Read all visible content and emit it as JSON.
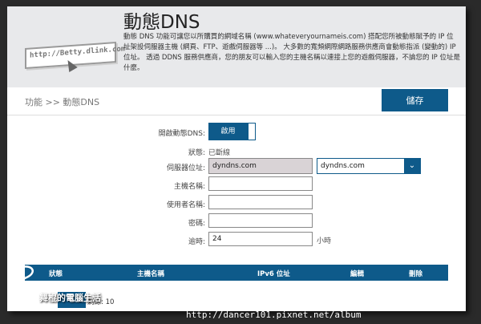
{
  "header": {
    "title": "動態DNS",
    "description": "動態 DNS 功能可讓您以所購買的網域名稱 (www.whateveryournameis.com) 搭配您所被動態賦予的 IP 位址架設伺服器主機 (網頁、FTP、遊戲伺服器等 ...)。 大多數的寬頻網際網路服務供應商會動態指派 (變動的) IP 位址。 透過 DDNS 服務供應商，您的朋友可以輸入您的主機名稱以連接上您的遊戲伺服器，不論您的 IP 位址是什麼。",
    "illustration_url": "http://Betty.dlink.com"
  },
  "breadcrumb": "功能 >> 動態DNS",
  "save_label": "儲存",
  "form": {
    "enable_label": "開啟動態DNS:",
    "enable_value": "啟用",
    "status_label": "狀態:",
    "status_value": "已斷線",
    "server_label": "伺服器位址:",
    "server_value": "dyndns.com",
    "server_select": "dyndns.com",
    "host_label": "主機名稱:",
    "host_value": "",
    "user_label": "使用者名稱:",
    "user_value": "",
    "password_label": "密碼:",
    "password_value": "",
    "timeout_label": "逾時:",
    "timeout_value": "24",
    "timeout_unit": "小時"
  },
  "table": {
    "headers": [
      "狀態",
      "主機名稱",
      "IPv6 位址",
      "編輯",
      "刪除"
    ]
  },
  "remaining": "剩餘: 10",
  "watermark": {
    "url": "http://dancer101.pixnet.net/album",
    "logo_text": "舞棍的電腦生活"
  },
  "colors": {
    "accent": "#0e5a8a",
    "header_bg": "#e8e9eb"
  }
}
